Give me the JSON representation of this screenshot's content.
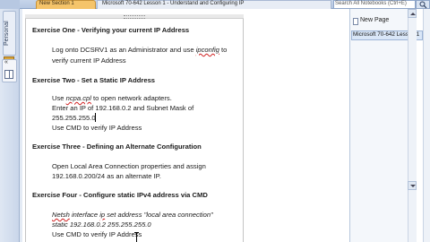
{
  "left_strip": {
    "notebook_label": "Personal",
    "tab2_label": "«"
  },
  "tabs": {
    "section_tab": "New Section 1",
    "page_title": "Microsoft 70-642 Lesson 1 - Understand and Configuring IP"
  },
  "search": {
    "placeholder": "Search All Notebooks (Ctrl+E)"
  },
  "page_list": {
    "new_page": "New Page",
    "pages": [
      "Microsoft 70-642 Lesson 1"
    ]
  },
  "note": {
    "ex1_heading": "Exercise One - Verifying your current IP Address",
    "ex1_line1_a": "Log onto DCSRV1 as an Administrator and use ",
    "ex1_line1_b": "ipconfig",
    "ex1_line1_c": " to",
    "ex1_line2": "verify current IP Address",
    "ex2_heading": "Exercise Two - Set a Static IP Address",
    "ex2_line1_a": "Use ",
    "ex2_line1_b": "ncpa.cpl",
    "ex2_line1_c": " to open network adapters.",
    "ex2_line2": "Enter an IP of 192.168.0.2  and Subnet Mask of",
    "ex2_line3": "255.255.255.0",
    "ex2_line4": "Use CMD to verify IP Address",
    "ex3_heading": "Exercise Three - Defining an Alternate Configuration",
    "ex3_line1": "Open Local Area Connection properties and assign",
    "ex3_line2": "192.168.0.200/24  as an alternate IP.",
    "ex4_heading": "Exercise Four - Configure static IPv4 address via CMD",
    "ex4_line1_a": "Netsh",
    "ex4_line1_b": " interface ",
    "ex4_line1_c": "ip",
    "ex4_line1_d": " set address  \"local area connection\"",
    "ex4_line2": "static 192.168.0.2  255.255.255.0",
    "ex4_line3": "Use CMD to verify IP Address"
  }
}
